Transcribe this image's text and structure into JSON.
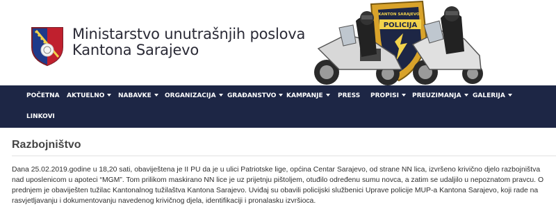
{
  "site": {
    "title_line1": "Ministarstvo unutrašnjih poslova",
    "title_line2": "Kantona Sarajevo",
    "badge_text_top": "KANTON SARAJEVO",
    "badge_text_main": "POLICIJA"
  },
  "nav": {
    "items": [
      {
        "label": "Početna",
        "dropdown": false
      },
      {
        "label": "Aktuelno",
        "dropdown": true
      },
      {
        "label": "Nabavke",
        "dropdown": true
      },
      {
        "label": "Organizacija",
        "dropdown": true
      },
      {
        "label": "Građanstvo",
        "dropdown": true
      },
      {
        "label": "Kampanje",
        "dropdown": true
      },
      {
        "label": "Press",
        "dropdown": false
      },
      {
        "label": "Propisi",
        "dropdown": true
      },
      {
        "label": "Preuzimanja",
        "dropdown": true
      },
      {
        "label": "Galerija",
        "dropdown": true
      },
      {
        "label": "Linkovi",
        "dropdown": false
      }
    ]
  },
  "article": {
    "title": "Razbojništvo",
    "body": "Dana 25.02.2019.godine u 18,20 sati, obaviještena je II PU da je u ulici Patriotske lige, općina Centar Sarajevo, od strane NN lica, izvršeno krivično djelo razbojništva nad uposlenicom u apoteci “MGM”. Tom prilikom maskirano NN lice je uz prijetnju pištoljem, otuđilo određenu sumu novca, a zatim se udaljilo u nepoznatom pravcu. O prednjem je obaviješten tužilac Kantonalnog tužilaštva Kantona Sarajevo. Uviđaj su obavili policijski službenici Uprave policije MUP-a Kantona Sarajevo, koji rade na rasvjetljavanju i dokumentovanju navedenog krivičnog djela, identifikaciji i pronalasku izvršioca."
  },
  "colors": {
    "navbar": "#1d2645",
    "nav_text": "#ffffff",
    "crest_blue": "#1f3a8a",
    "crest_red": "#c0202e"
  },
  "icons": {
    "crest": "ministry-crest-icon",
    "caret": "caret-down-icon"
  }
}
